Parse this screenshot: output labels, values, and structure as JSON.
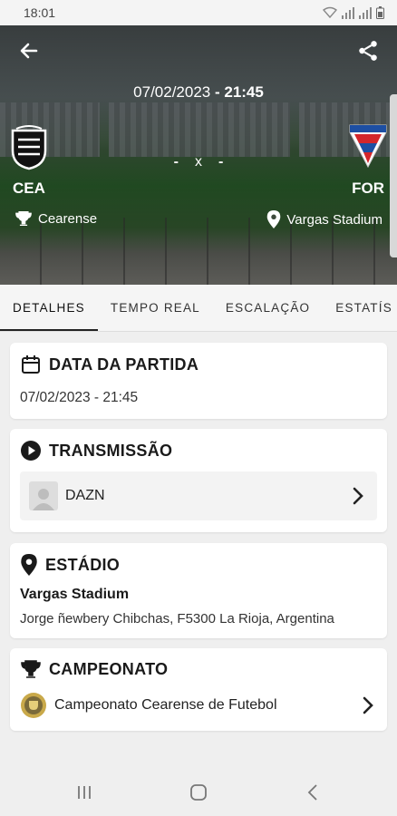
{
  "status_bar": {
    "time": "18:01"
  },
  "header": {
    "date": "07/02/2023",
    "separator": " - ",
    "time": "21:45",
    "score_home": "-",
    "score_sep": "x",
    "score_away": "-",
    "home": {
      "code": "CEA",
      "competition": "Cearense"
    },
    "away": {
      "code": "FOR",
      "venue": "Vargas Stadium"
    }
  },
  "tabs": [
    {
      "label": "DETALHES"
    },
    {
      "label": "TEMPO REAL"
    },
    {
      "label": "ESCALAÇÃO"
    },
    {
      "label": "ESTATÍS"
    }
  ],
  "cards": {
    "date": {
      "title": "DATA DA PARTIDA",
      "value": "07/02/2023 - 21:45"
    },
    "broadcast": {
      "title": "TRANSMISSÃO",
      "provider": "DAZN"
    },
    "stadium": {
      "title": "ESTÁDIO",
      "name": "Vargas Stadium",
      "address": "Jorge ñewbery Chibchas, F5300 La Rioja, Argentina"
    },
    "championship": {
      "title": "CAMPEONATO",
      "name": "Campeonato Cearense de Futebol"
    }
  },
  "icons": {
    "back": "arrow-left-icon",
    "share": "share-icon",
    "trophy": "trophy-icon",
    "location": "location-pin-icon",
    "calendar": "calendar-icon",
    "play": "play-circle-icon",
    "chevron": "chevron-right-icon"
  },
  "colors": {
    "accent": "#222222",
    "background": "#efefef",
    "home_crest": "#111111",
    "away_crest_blue": "#1d4fa3",
    "away_crest_red": "#d3262b"
  }
}
